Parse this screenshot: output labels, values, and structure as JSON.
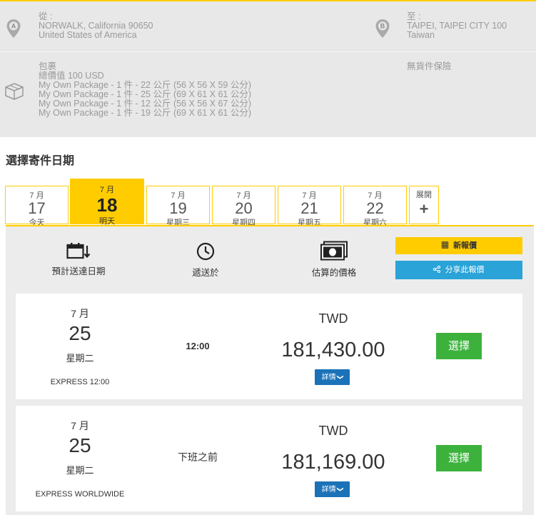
{
  "from": {
    "label": "從 :",
    "line1": "NORWALK, California 90650",
    "line2": "United States of America"
  },
  "to": {
    "label": "至 :",
    "line1": "TAIPEI, TAIPEI CITY 100",
    "line2": "Taiwan"
  },
  "package": {
    "title": "包裹",
    "total_value": "總價值 100 USD",
    "items": [
      "My Own Package - 1 件 - 22 公斤 (56 X 56 X 59 公分)",
      "My Own Package - 1 件 - 25 公斤 (69 X 61 X 61 公分)",
      "My Own Package - 1 件 - 12 公斤 (56 X 56 X 67 公分)",
      "My Own Package - 1 件 - 19 公斤 (69 X 61 X 61 公分)"
    ],
    "insurance": "無貨件保險"
  },
  "section_title": "選擇寄件日期",
  "date_tabs": [
    {
      "month": "7 月",
      "day": "17",
      "weekday": "今天"
    },
    {
      "month": "7 月",
      "day": "18",
      "weekday": "明天"
    },
    {
      "month": "7 月",
      "day": "19",
      "weekday": "星期三"
    },
    {
      "month": "7 月",
      "day": "20",
      "weekday": "星期四"
    },
    {
      "month": "7 月",
      "day": "21",
      "weekday": "星期五"
    },
    {
      "month": "7 月",
      "day": "22",
      "weekday": "星期六"
    }
  ],
  "selected_tab": 1,
  "expand_tab": {
    "label": "展開",
    "symbol": "+"
  },
  "columns": {
    "delivery_date": "預計送達日期",
    "delivered_by": "遞送於",
    "estimated_price": "估算的價格"
  },
  "actions": {
    "new_quote": "新報價",
    "share_quote": "分享此報價"
  },
  "quotes": [
    {
      "month": "7 月",
      "day": "25",
      "weekday": "星期二",
      "service": "EXPRESS 12:00",
      "time": "12:00",
      "currency": "TWD",
      "amount": "181,430.00",
      "details_label": "詳情",
      "select_label": "選擇"
    },
    {
      "month": "7 月",
      "day": "25",
      "weekday": "星期二",
      "service": "EXPRESS WORLDWIDE",
      "time": "下班之前",
      "currency": "TWD",
      "amount": "181,169.00",
      "details_label": "詳情",
      "select_label": "選擇"
    }
  ],
  "colors": {
    "brand_yellow": "#ffcc00",
    "share_blue": "#2aa3d8",
    "details_blue": "#1b72b8",
    "select_green": "#3cb23c",
    "summary_bg": "#e8e8e8"
  }
}
